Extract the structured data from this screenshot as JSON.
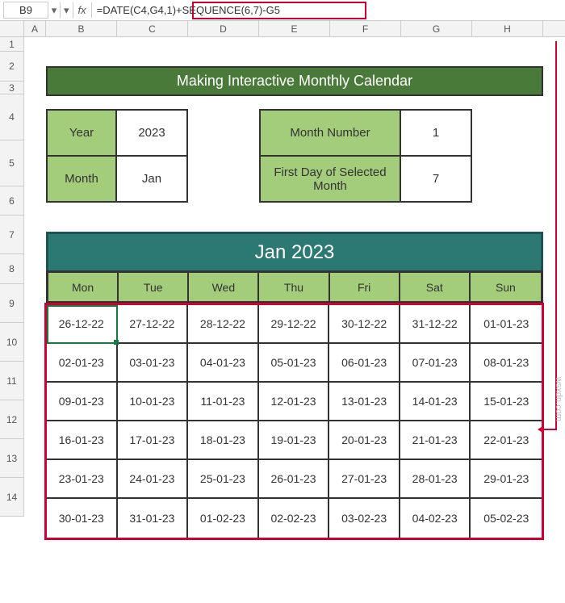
{
  "name_box": "B9",
  "fx_label": "fx",
  "formula": "=DATE(C4,G4,1)+SEQUENCE(6,7)-G5",
  "columns": [
    "A",
    "B",
    "C",
    "D",
    "E",
    "F",
    "G",
    "H"
  ],
  "rows": {
    "r1": "1",
    "r2": "2",
    "r3": "3",
    "r4": "4",
    "r5": "5",
    "r6": "6",
    "r7": "7",
    "r8": "8",
    "r9": "9",
    "r10": "10",
    "r11": "11",
    "r12": "12",
    "r13": "13",
    "r14": "14"
  },
  "title": "Making Interactive Monthly Calendar",
  "info": {
    "year_label": "Year",
    "year_value": "2023",
    "month_label": "Month",
    "month_value": "Jan",
    "mnum_label": "Month Number",
    "mnum_value": "1",
    "fday_label": "First Day of Selected Month",
    "fday_value": "7"
  },
  "cal_title": "Jan 2023",
  "days": [
    "Mon",
    "Tue",
    "Wed",
    "Thu",
    "Fri",
    "Sat",
    "Sun"
  ],
  "grid": [
    [
      "26-12-22",
      "27-12-22",
      "28-12-22",
      "29-12-22",
      "30-12-22",
      "31-12-22",
      "01-01-23"
    ],
    [
      "02-01-23",
      "03-01-23",
      "04-01-23",
      "05-01-23",
      "06-01-23",
      "07-01-23",
      "08-01-23"
    ],
    [
      "09-01-23",
      "10-01-23",
      "11-01-23",
      "12-01-23",
      "13-01-23",
      "14-01-23",
      "15-01-23"
    ],
    [
      "16-01-23",
      "17-01-23",
      "18-01-23",
      "19-01-23",
      "20-01-23",
      "21-01-23",
      "22-01-23"
    ],
    [
      "23-01-23",
      "24-01-23",
      "25-01-23",
      "26-01-23",
      "27-01-23",
      "28-01-23",
      "29-01-23"
    ],
    [
      "30-01-23",
      "31-01-23",
      "01-02-23",
      "02-02-23",
      "03-02-23",
      "04-02-23",
      "05-02-23"
    ]
  ],
  "watermark": "wsxdn.com"
}
